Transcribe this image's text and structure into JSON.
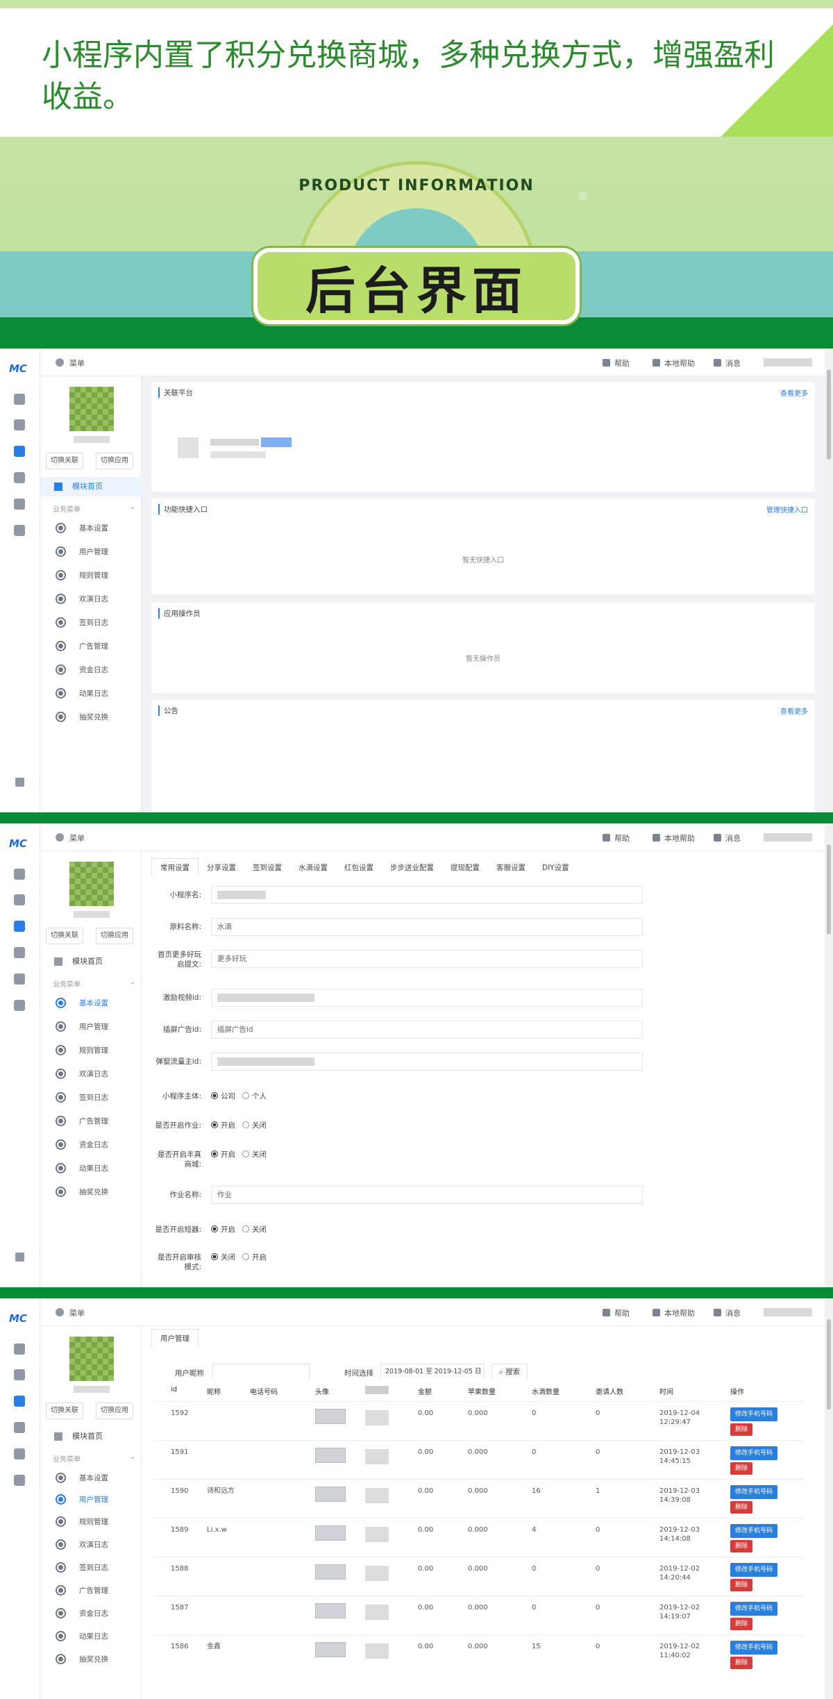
{
  "hero": {
    "headline": "小程序内置了积分兑换商城，多种兑换方式，增强盈利收益。",
    "arc_title": "PRODUCT INFORMATION",
    "badge_title": "后台界面"
  },
  "colors": {
    "brand_green": "#0a8c36",
    "accent_blue": "#2a7de1",
    "danger": "#d93b3b"
  },
  "app": {
    "logo": "MC",
    "menu_label": "菜单",
    "topbar": {
      "help": "帮助",
      "local_help": "本地帮助",
      "messages": "消息"
    },
    "switch_account": "切换关联",
    "switch_app": "切换应用",
    "home": "模块首页",
    "group_title": "业务菜单",
    "menu": [
      "基本设置",
      "用户管理",
      "规则管理",
      "欢演日志",
      "签到日志",
      "广告管理",
      "资金日志",
      "动果日志",
      "抽奖兑换"
    ]
  },
  "panel1": {
    "cards": [
      {
        "title": "关联平台",
        "link": "查看更多"
      },
      {
        "title": "功能快捷入口",
        "link": "管理快捷入口",
        "empty": "暂无快捷入口"
      },
      {
        "title": "应用操作员",
        "empty": "暂无操作员"
      },
      {
        "title": "公告",
        "link": "查看更多"
      }
    ]
  },
  "panel2": {
    "tabs": [
      "常用设置",
      "分享设置",
      "签到设置",
      "水滴设置",
      "红包设置",
      "步步送业配置",
      "提现配置",
      "客服设置",
      "DIY设置"
    ],
    "fields": [
      {
        "label": "小程序名:",
        "value": ""
      },
      {
        "label": "原料名称:",
        "value": "水滴"
      },
      {
        "label": "首页更多好玩启提文:",
        "value": "更多好玩"
      },
      {
        "label": "激励视频id:",
        "value": ""
      },
      {
        "label": "插屏广告id:",
        "value": "插屏广告id"
      },
      {
        "label": "弹窗流量主id:",
        "value": ""
      },
      {
        "label": "作业名称:",
        "value": "作业"
      }
    ],
    "radios": [
      {
        "label": "小程序主体:",
        "opt1": "公司",
        "opt2": "个人"
      },
      {
        "label": "是否开启作业:",
        "opt1": "开启",
        "opt2": "关闭"
      },
      {
        "label": "是否开启丰真商城:",
        "opt1": "开启",
        "opt2": "关闭"
      },
      {
        "label": "是否开启短器:",
        "opt1": "开启",
        "opt2": "关闭"
      },
      {
        "label": "是否开启审核模式:",
        "opt1": "关闭",
        "opt2": "开启"
      }
    ]
  },
  "panel3": {
    "tab": "用户管理",
    "search_label": "用户昵称",
    "time_label": "时间选择",
    "time_range": "2019-08-01 至 2019-12-05 日",
    "search_btn": "搜索",
    "columns": [
      "id",
      "昵称",
      "电话号码",
      "头像",
      "",
      "金额",
      "苹果数量",
      "水滴数量",
      "邀请人数",
      "时间",
      "操作"
    ],
    "btn_modify": "修改手机号码",
    "btn_delete": "删除",
    "rows": [
      {
        "id": "1592",
        "nick": "",
        "amount": "0.00",
        "apple": "0.000",
        "drop": "0",
        "invite": "0",
        "date": "2019-12-04",
        "time": "12:29:47"
      },
      {
        "id": "1591",
        "nick": "",
        "amount": "0.00",
        "apple": "0.000",
        "drop": "0",
        "invite": "0",
        "date": "2019-12-03",
        "time": "14:45:15"
      },
      {
        "id": "1590",
        "nick": "诗和远方",
        "amount": "0.00",
        "apple": "0.000",
        "drop": "16",
        "invite": "1",
        "date": "2019-12-03",
        "time": "14:39:08"
      },
      {
        "id": "1589",
        "nick": "Li.x.w",
        "amount": "0.00",
        "apple": "0.000",
        "drop": "4",
        "invite": "0",
        "date": "2019-12-03",
        "time": "14:14:08"
      },
      {
        "id": "1588",
        "nick": "",
        "amount": "0.00",
        "apple": "0.000",
        "drop": "0",
        "invite": "0",
        "date": "2019-12-02",
        "time": "14:20:44"
      },
      {
        "id": "1587",
        "nick": "",
        "amount": "0.00",
        "apple": "0.000",
        "drop": "0",
        "invite": "0",
        "date": "2019-12-02",
        "time": "14:19:07"
      },
      {
        "id": "1586",
        "nick": "金鑫",
        "amount": "0.00",
        "apple": "0.000",
        "drop": "15",
        "invite": "0",
        "date": "2019-12-02",
        "time": "11:40:02"
      }
    ]
  }
}
